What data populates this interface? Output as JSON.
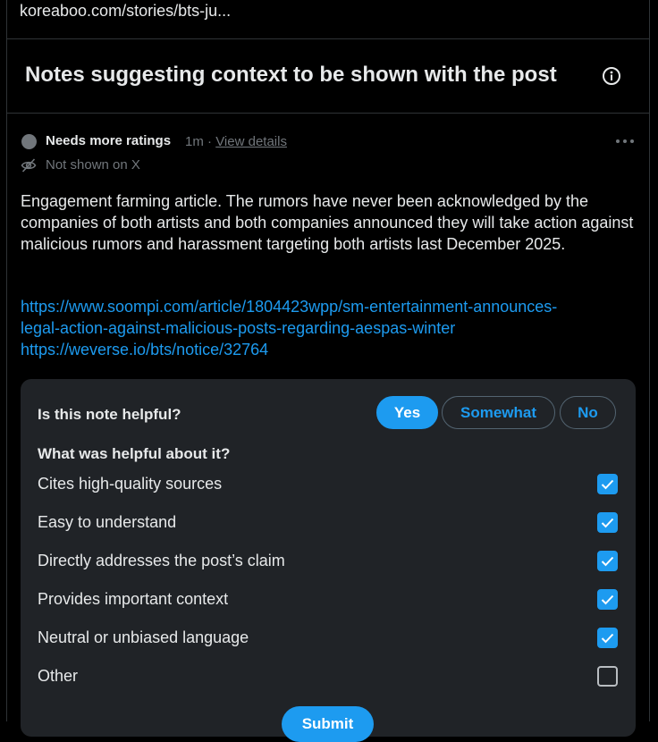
{
  "browser": {
    "url": "koreaboo.com/stories/bts-ju..."
  },
  "section": {
    "title": "Notes suggesting context to be shown with the post",
    "info_icon": "info-icon"
  },
  "note": {
    "status": "Needs more ratings",
    "age": "1m",
    "separator": "·",
    "view_details": "View details",
    "visibility": "Not shown on X",
    "body": "Engagement farming article. The rumors have never been acknowledged by the companies of both artists and both companies announced they will take action against malicious rumors and harassment targeting both artists last December 2025.",
    "links": [
      "https://www.soompi.com/article/1804423wpp/sm-entertainment-announces-",
      "legal-action-against-malicious-posts-regarding-aespas-winter",
      "https://weverse.io/bts/notice/32764"
    ]
  },
  "rating": {
    "question": "Is this note helpful?",
    "options": {
      "yes": "Yes",
      "somewhat": "Somewhat",
      "no": "No"
    },
    "selected": "yes",
    "helpful_question": "What was helpful about it?",
    "reasons": [
      {
        "label": "Cites high-quality sources",
        "checked": true
      },
      {
        "label": "Easy to understand",
        "checked": true
      },
      {
        "label": "Directly addresses the post’s claim",
        "checked": true
      },
      {
        "label": "Provides important context",
        "checked": true
      },
      {
        "label": "Neutral or unbiased language",
        "checked": true
      },
      {
        "label": "Other",
        "checked": false
      }
    ],
    "submit": "Submit"
  },
  "colors": {
    "accent": "#1d9bf0",
    "background": "#000000",
    "panel": "#202327",
    "muted": "#71767b"
  }
}
